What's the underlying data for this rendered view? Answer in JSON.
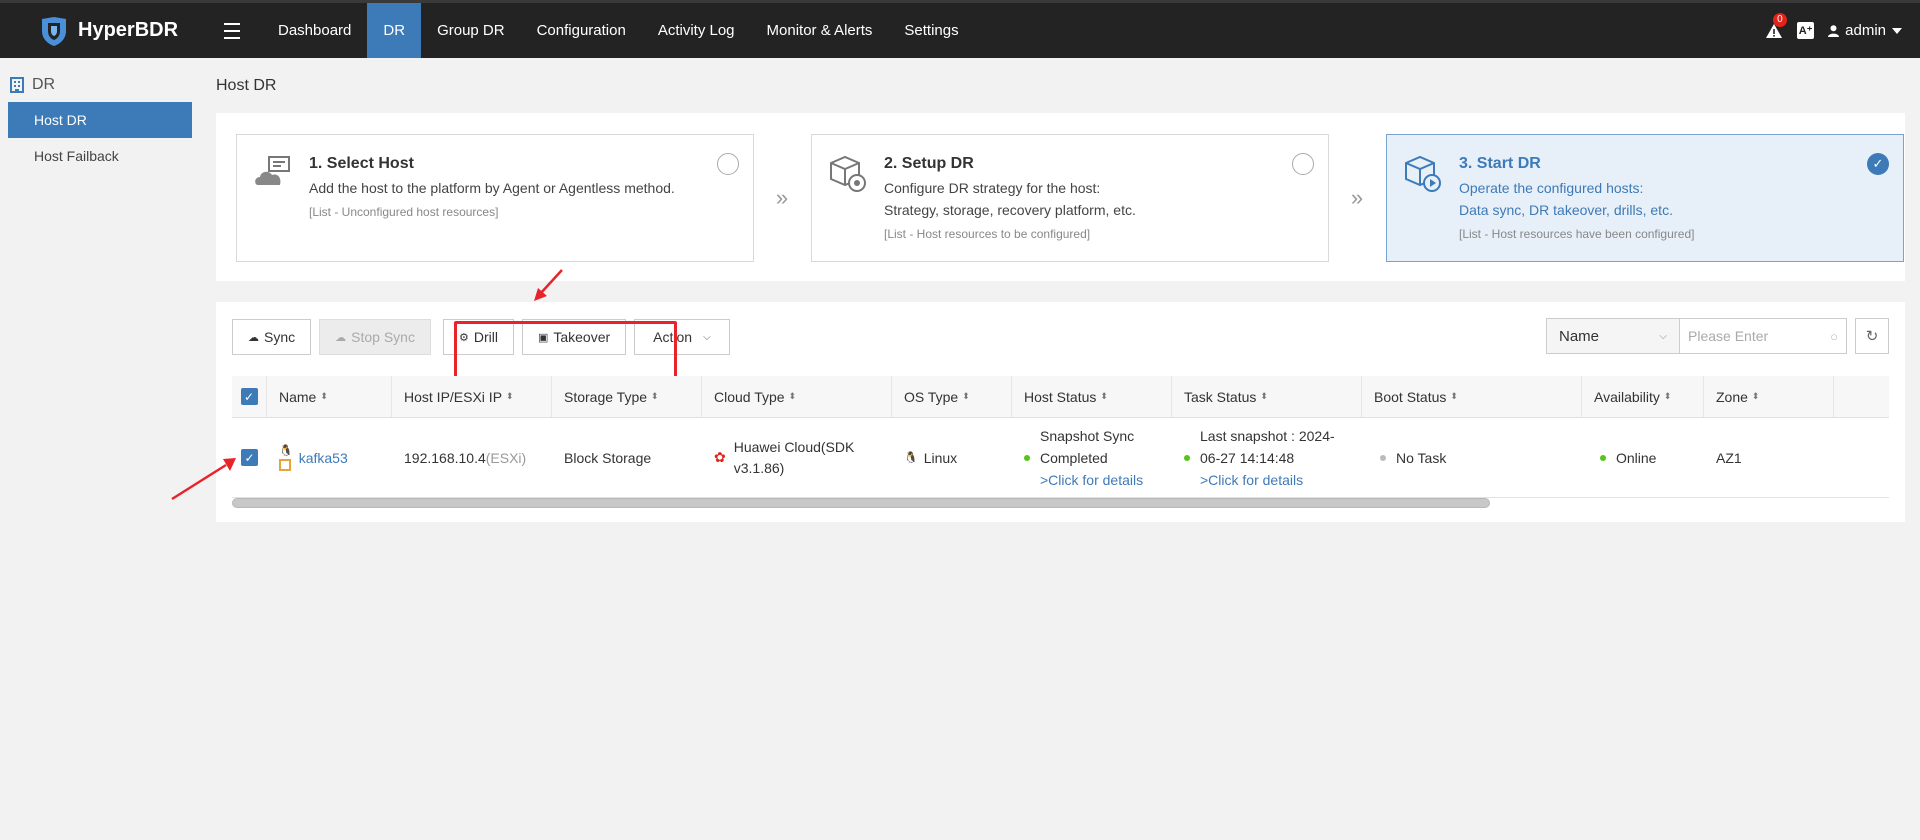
{
  "app": {
    "name": "HyperBDR"
  },
  "nav": {
    "items": [
      "Dashboard",
      "DR",
      "Group DR",
      "Configuration",
      "Activity Log",
      "Monitor & Alerts",
      "Settings"
    ],
    "active": "DR"
  },
  "header": {
    "alert_count": "0",
    "font_icon": "A⁺",
    "user": "admin"
  },
  "sidebar": {
    "section": "DR",
    "items": [
      {
        "label": "Host DR",
        "active": true
      },
      {
        "label": "Host Failback",
        "active": false
      }
    ]
  },
  "page": {
    "title": "Host DR"
  },
  "steps": [
    {
      "title": "1. Select Host",
      "desc_lines": [
        "Add the host to the platform by Agent or Agentless method."
      ],
      "note": "[List - Unconfigured host resources]",
      "done": false
    },
    {
      "title": "2. Setup DR",
      "desc_lines": [
        "Configure DR strategy for the host:",
        "Strategy, storage, recovery platform, etc."
      ],
      "note": "[List - Host resources to be configured]",
      "done": false
    },
    {
      "title": "3. Start DR",
      "desc_lines": [
        "Operate the configured hosts:",
        "Data sync, DR takeover, drills, etc."
      ],
      "note": "[List - Host resources have been configured]",
      "done": true
    }
  ],
  "toolbar": {
    "sync": "Sync",
    "stop_sync": "Stop Sync",
    "drill": "Drill",
    "takeover": "Takeover",
    "action": "Action"
  },
  "search": {
    "field": "Name",
    "placeholder": "Please Enter"
  },
  "table": {
    "columns": [
      "Name",
      "Host IP/ESXi IP",
      "Storage Type",
      "Cloud Type",
      "OS Type",
      "Host Status",
      "Task Status",
      "Boot Status",
      "Availability",
      "Zone"
    ],
    "rows": [
      {
        "name": "kafka53",
        "ip": "192.168.10.4",
        "ip_suffix": "(ESXi)",
        "storage": "Block Storage",
        "cloud_line1": "Huawei Cloud(SDK",
        "cloud_line2": "v3.1.86)",
        "os": "Linux",
        "host_status_line1": "Snapshot Sync",
        "host_status_line2": "Completed",
        "host_status_link": ">Click for details",
        "task_status_line1": "Last snapshot : 2024-",
        "task_status_line2": "06-27 14:14:48",
        "task_status_link": ">Click for details",
        "boot_status": "No Task",
        "availability": "Online",
        "zone": "AZ1"
      }
    ]
  },
  "colors": {
    "accent": "#3d7ab8",
    "highlight": "#e8232a",
    "success": "#52c41a",
    "neutral": "#bbbbbb"
  }
}
